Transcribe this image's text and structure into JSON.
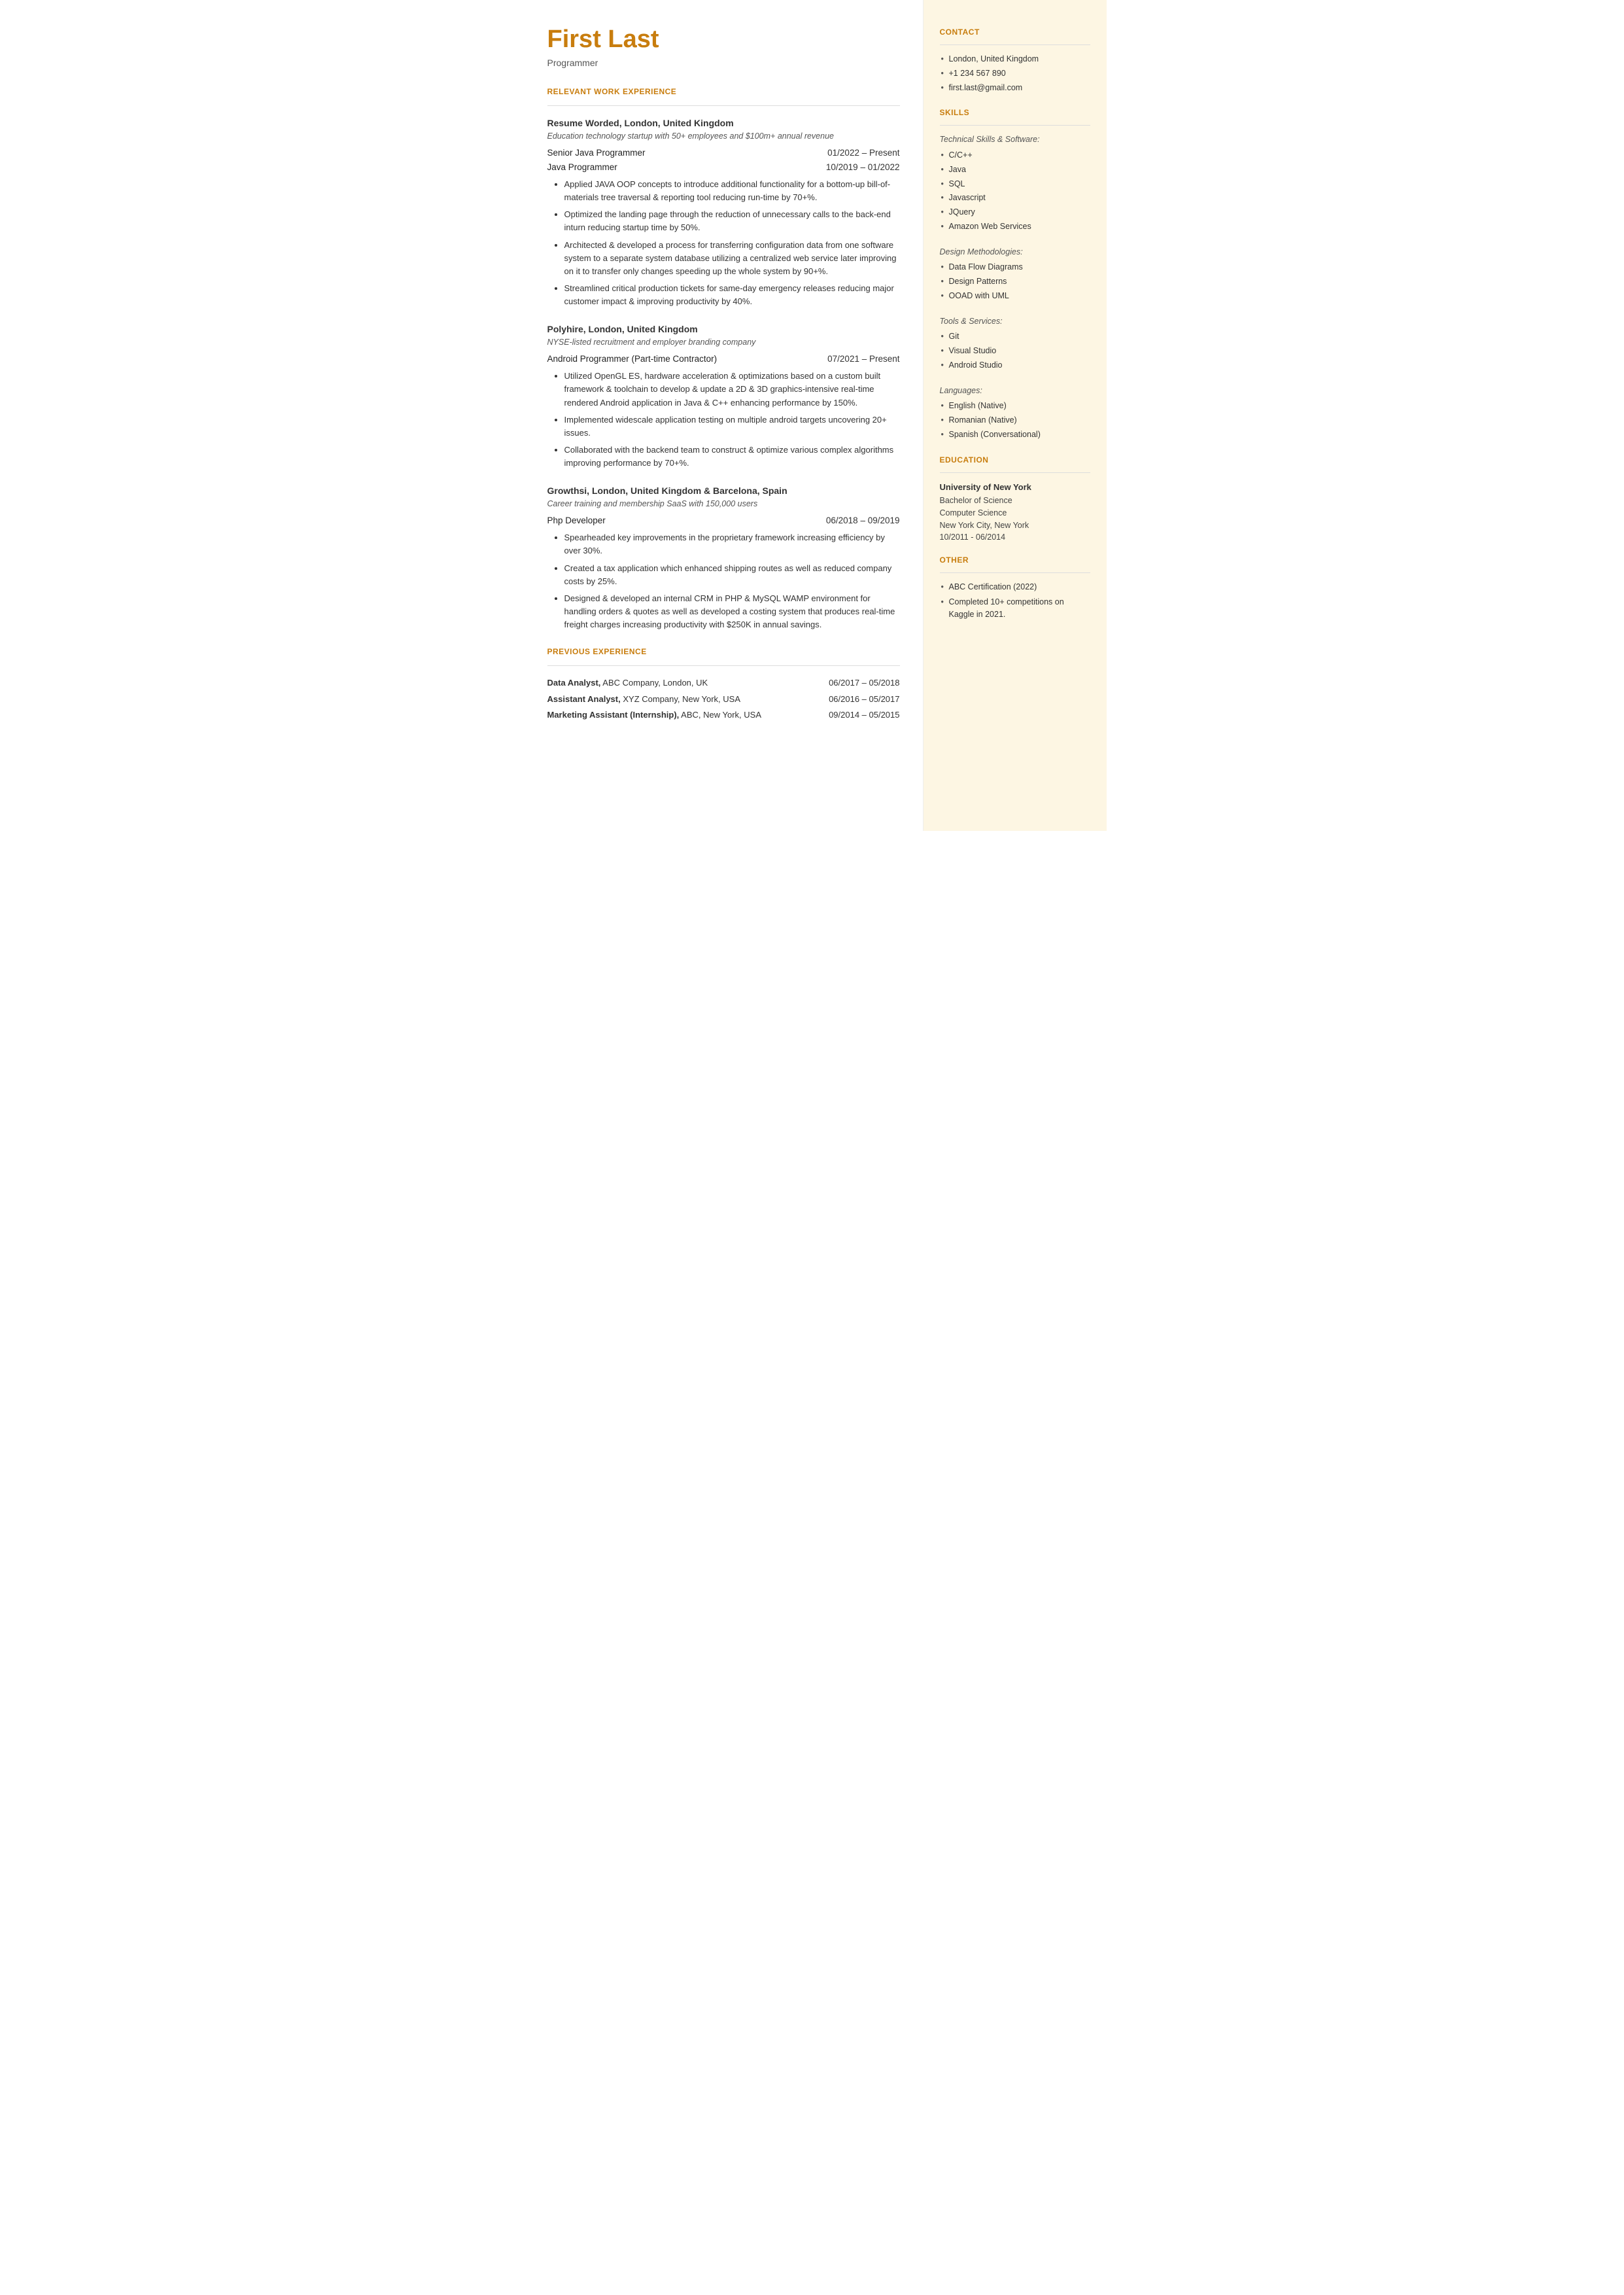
{
  "header": {
    "name": "First Last",
    "title": "Programmer"
  },
  "sections": {
    "relevant_work": "RELEVANT WORK EXPERIENCE",
    "previous": "PREVIOUS EXPERIENCE"
  },
  "companies": [
    {
      "name": "Resume Worded,",
      "location": "London, United Kingdom",
      "tagline": "Education technology startup with 50+ employees and $100m+ annual revenue",
      "roles": [
        {
          "title": "Senior Java Programmer",
          "dates": "01/2022 – Present"
        },
        {
          "title": "Java Programmer",
          "dates": "10/2019 – 01/2022"
        }
      ],
      "bullets": [
        "Applied JAVA OOP concepts to introduce additional functionality for a bottom-up bill-of-materials tree traversal & reporting tool reducing run-time by 70+%.",
        "Optimized the landing page through the reduction of unnecessary calls to the back-end inturn reducing startup time by 50%.",
        "Architected & developed a process for transferring configuration data from one software system to a separate system database utilizing a centralized web service later improving on it to transfer only changes speeding up the whole system by 90+%.",
        "Streamlined critical production tickets for same-day emergency releases reducing major customer impact & improving productivity by 40%."
      ]
    },
    {
      "name": "Polyhire,",
      "location": "London, United Kingdom",
      "tagline": "NYSE-listed recruitment and employer branding company",
      "roles": [
        {
          "title": "Android Programmer (Part-time Contractor)",
          "dates": "07/2021 – Present"
        }
      ],
      "bullets": [
        "Utilized OpenGL ES, hardware acceleration & optimizations based on a custom built framework & toolchain to develop & update a 2D & 3D graphics-intensive real-time rendered Android application in Java & C++ enhancing performance by 150%.",
        "Implemented widescale application testing on multiple android targets uncovering 20+ issues.",
        "Collaborated with the backend team to construct & optimize various complex algorithms improving performance by 70+%."
      ]
    },
    {
      "name": "Growthsi,",
      "location": "London, United Kingdom & Barcelona, Spain",
      "tagline": "Career training and membership SaaS with 150,000 users",
      "roles": [
        {
          "title": "Php Developer",
          "dates": "06/2018 – 09/2019"
        }
      ],
      "bullets": [
        "Spearheaded key improvements in the proprietary framework increasing efficiency by over 30%.",
        "Created a tax application which enhanced shipping routes as well as reduced company costs by 25%.",
        "Designed & developed an internal CRM in PHP & MySQL WAMP environment for handling orders & quotes as well as developed a costing system that produces real-time freight charges increasing productivity with $250K in annual savings."
      ]
    }
  ],
  "previous_exp": [
    {
      "job": "Data Analyst,",
      "company": " ABC Company, London, UK",
      "dates": "06/2017 – 05/2018"
    },
    {
      "job": "Assistant Analyst,",
      "company": " XYZ Company, New York, USA",
      "dates": "06/2016 – 05/2017"
    },
    {
      "job": "Marketing Assistant (Internship),",
      "company": " ABC, New York, USA",
      "dates": "09/2014 – 05/2015"
    }
  ],
  "right": {
    "contact_title": "CONTACT",
    "contact": [
      "London, United Kingdom",
      "+1 234 567 890",
      "first.last@gmail.com"
    ],
    "skills_title": "SKILLS",
    "technical_label": "Technical Skills & Software:",
    "technical": [
      "C/C++",
      "Java",
      "SQL",
      "Javascript",
      "JQuery",
      "Amazon Web Services"
    ],
    "design_label": "Design Methodologies:",
    "design": [
      "Data Flow Diagrams",
      "Design Patterns",
      "OOAD with UML"
    ],
    "tools_label": "Tools & Services:",
    "tools": [
      "Git",
      "Visual Studio",
      "Android Studio"
    ],
    "languages_label": "Languages:",
    "languages": [
      "English (Native)",
      "Romanian (Native)",
      "Spanish (Conversational)"
    ],
    "education_title": "EDUCATION",
    "education": [
      {
        "school": "University of New York",
        "degree": "Bachelor of Science",
        "field": "Computer Science",
        "location": "New York City, New York",
        "dates": "10/2011 - 06/2014"
      }
    ],
    "other_title": "OTHER",
    "other": [
      "ABC Certification (2022)",
      "Completed 10+ competitions on Kaggle in 2021."
    ]
  }
}
